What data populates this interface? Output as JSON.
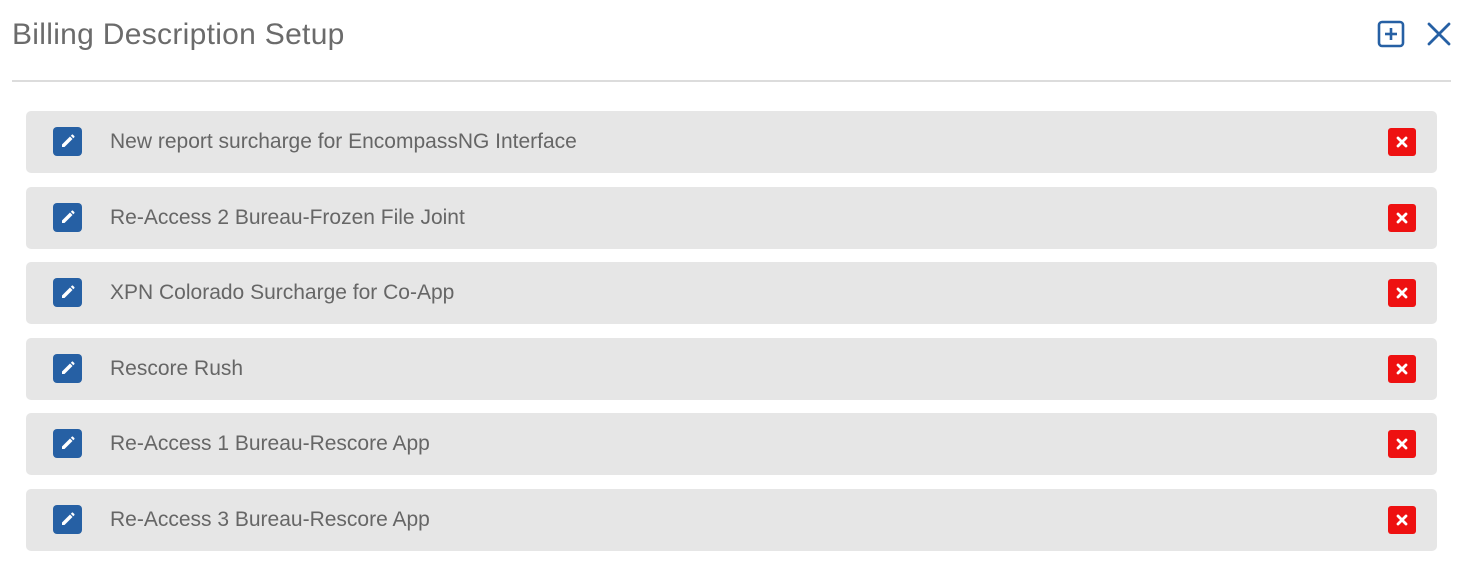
{
  "dialog": {
    "title": "Billing Description Setup",
    "add_icon": "add-square-icon",
    "close_icon": "close-icon"
  },
  "colors": {
    "accent": "#2660a4",
    "delete": "#ee1111",
    "row_bg": "#e6e6e6",
    "text": "#666666"
  },
  "items": [
    {
      "label": "New report surcharge for EncompassNG Interface"
    },
    {
      "label": "Re-Access 2 Bureau-Frozen File Joint"
    },
    {
      "label": "XPN Colorado Surcharge for Co-App"
    },
    {
      "label": "Rescore Rush"
    },
    {
      "label": "Re-Access 1 Bureau-Rescore App"
    },
    {
      "label": "Re-Access 3 Bureau-Rescore App"
    }
  ],
  "row_icons": {
    "edit_icon": "pencil-icon",
    "delete_icon": "x-icon"
  }
}
